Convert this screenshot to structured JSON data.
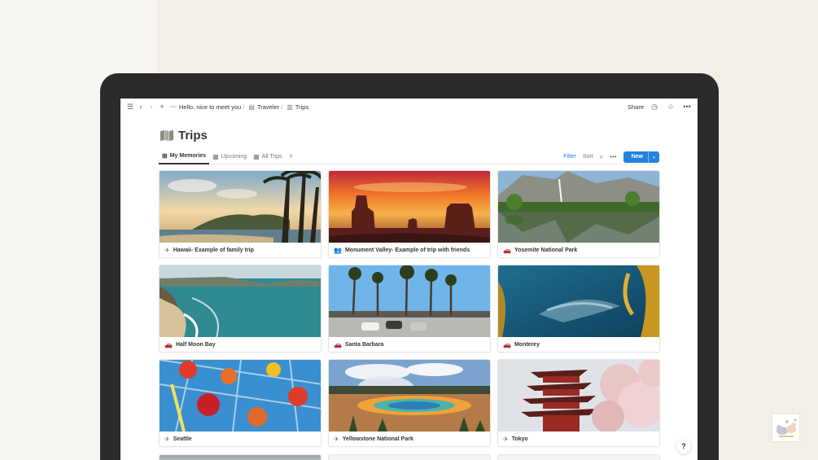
{
  "topbar": {
    "breadcrumbs": [
      {
        "icon": "wave-icon",
        "label": "Hello, nice to meet you"
      },
      {
        "icon": "page-icon",
        "label": "Traveler"
      },
      {
        "icon": "map-icon",
        "label": "Trips"
      }
    ],
    "share_label": "Share",
    "sep": "/"
  },
  "page": {
    "title": "Trips",
    "icon": "map-icon"
  },
  "views": {
    "tabs": [
      {
        "label": "My Memories",
        "icon": "gallery-icon",
        "active": true
      },
      {
        "label": "Upcoming",
        "icon": "table-icon",
        "active": false
      },
      {
        "label": "All Trips",
        "icon": "table-icon",
        "active": false
      }
    ],
    "add": "+",
    "filter": "Filter",
    "sort": "Sort",
    "new_label": "New"
  },
  "gallery": {
    "cards": [
      {
        "title": "Hawaii- Example of family trip",
        "icon": "airplane-icon"
      },
      {
        "title": "Monument Valley- Example of trip with friends",
        "icon": "people-icon"
      },
      {
        "title": "Yosemite National Park",
        "icon": "car-icon"
      },
      {
        "title": "Half Moon Bay",
        "icon": "car-icon"
      },
      {
        "title": "Santa Barbara",
        "icon": "car-icon"
      },
      {
        "title": "Monterey",
        "icon": "car-icon"
      },
      {
        "title": "Seattle",
        "icon": "airplane-icon"
      },
      {
        "title": "Yellowstone National Park",
        "icon": "airplane-icon"
      },
      {
        "title": "Tokyo",
        "icon": "airplane-icon"
      }
    ]
  },
  "help": "?",
  "colors": {
    "accent": "#2383e2",
    "text": "#37352f",
    "frame": "#2b2b2b"
  }
}
